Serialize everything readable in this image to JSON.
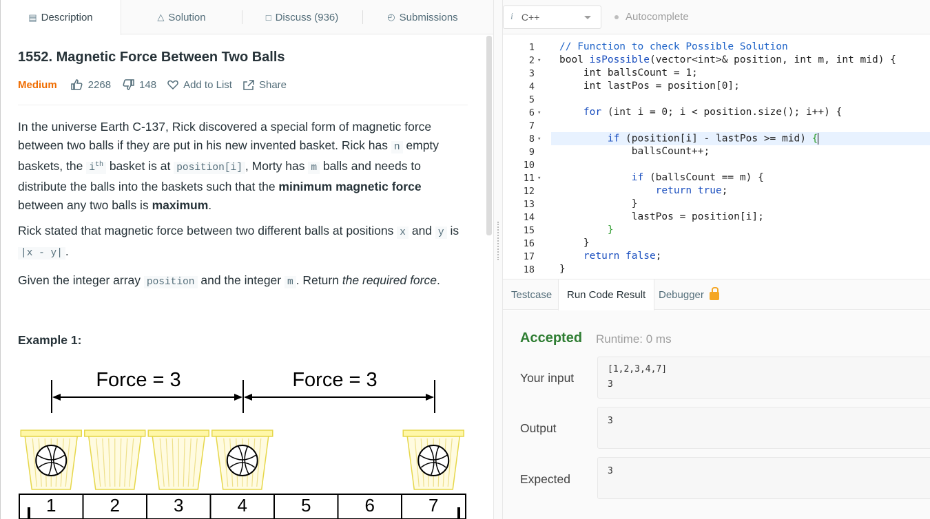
{
  "tabs": [
    {
      "label": "Description",
      "icon": "description-icon"
    },
    {
      "label": "Solution",
      "icon": "flask-icon"
    },
    {
      "label": "Discuss (936)",
      "icon": "discuss-icon"
    },
    {
      "label": "Submissions",
      "icon": "clock-icon"
    }
  ],
  "problem": {
    "title": "1552. Magnetic Force Between Two Balls",
    "difficulty": "Medium",
    "likes": "2268",
    "dislikes": "148",
    "add_to_list": "Add to List",
    "share": "Share"
  },
  "description": {
    "p1_a": "In the universe Earth C-137, Rick discovered a special form of magnetic force between two balls if they are put in his new invented basket. Rick has ",
    "p1_n": "n",
    "p1_b": " empty baskets, the ",
    "p1_i": "i",
    "p1_th": "th",
    "p1_c": " basket is at ",
    "p1_pos": "position[i]",
    "p1_d": ", Morty has ",
    "p1_m": "m",
    "p1_e": " balls and needs to distribute the balls into the baskets such that the ",
    "p1_bold1": "minimum magnetic force",
    "p1_f": " between any two balls is ",
    "p1_bold2": "maximum",
    "p1_g": ".",
    "p2_a": "Rick stated that magnetic force between two different balls at positions ",
    "p2_x": "x",
    "p2_and": " and ",
    "p2_y": "y",
    "p2_is": " is ",
    "p2_abs": "|x - y|",
    "p2_end": ".",
    "p3_a": "Given the integer array ",
    "p3_pos": "position",
    "p3_b": " and the integer ",
    "p3_m": "m",
    "p3_c": ". Return ",
    "p3_i": "the required force",
    "p3_d": ".",
    "example_title": "Example 1:"
  },
  "figure": {
    "force_labels": [
      "Force = 3",
      "Force = 3"
    ],
    "positions": [
      "1",
      "2",
      "3",
      "4",
      "5",
      "6",
      "7"
    ],
    "balls_at": [
      1,
      4,
      7
    ],
    "baskets_at": [
      1,
      2,
      3,
      4,
      7
    ]
  },
  "editor": {
    "language": "C++",
    "language_icon": "i",
    "autocomplete": "Autocomplete",
    "lines": [
      {
        "n": "1",
        "fold": false
      },
      {
        "n": "2",
        "fold": true
      },
      {
        "n": "3",
        "fold": false
      },
      {
        "n": "4",
        "fold": false
      },
      {
        "n": "5",
        "fold": false
      },
      {
        "n": "6",
        "fold": true
      },
      {
        "n": "7",
        "fold": false
      },
      {
        "n": "8",
        "fold": true
      },
      {
        "n": "9",
        "fold": false
      },
      {
        "n": "10",
        "fold": false
      },
      {
        "n": "11",
        "fold": true
      },
      {
        "n": "12",
        "fold": false
      },
      {
        "n": "13",
        "fold": false
      },
      {
        "n": "14",
        "fold": false
      },
      {
        "n": "15",
        "fold": false
      },
      {
        "n": "16",
        "fold": false
      },
      {
        "n": "17",
        "fold": false
      },
      {
        "n": "18",
        "fold": false
      }
    ],
    "code": {
      "l1": "// Function to check Possible Solution",
      "l2_kw": "bool",
      "l2_fn": "isPossible",
      "l2_a": "(vector<int>& position, int m, int mid) {",
      "l3": "    int ballsCount = 1;",
      "l4": "    int lastPos = position[0];",
      "l6_kw": "    for",
      "l6_rest": " (int i = 0; i < position.size(); i++) {",
      "l8_kw": "        if",
      "l8_rest": " (position[i] - lastPos >= mid) ",
      "l8_br": "{",
      "l9": "            ballsCount++;",
      "l11_kw": "            if",
      "l11_rest": " (ballsCount == m) {",
      "l12_kw": "                return",
      "l12_val": " true",
      "l12_end": ";",
      "l13": "            }",
      "l14": "            lastPos = position[i];",
      "l15": "        }",
      "l16": "    }",
      "l17_kw": "    return",
      "l17_val": " false",
      "l17_end": ";",
      "l18": "}"
    }
  },
  "result_tabs": [
    "Testcase",
    "Run Code Result",
    "Debugger"
  ],
  "result": {
    "status": "Accepted",
    "runtime": "Runtime: 0 ms",
    "your_input_label": "Your input",
    "your_input_line1": "[1,2,3,4,7]",
    "your_input_line2": "3",
    "output_label": "Output",
    "output_value": "3",
    "expected_label": "Expected",
    "expected_value": "3"
  },
  "colors": {
    "accepted": "#2e7d32",
    "medium": "#ef6c00",
    "lock": "#f5a623"
  }
}
